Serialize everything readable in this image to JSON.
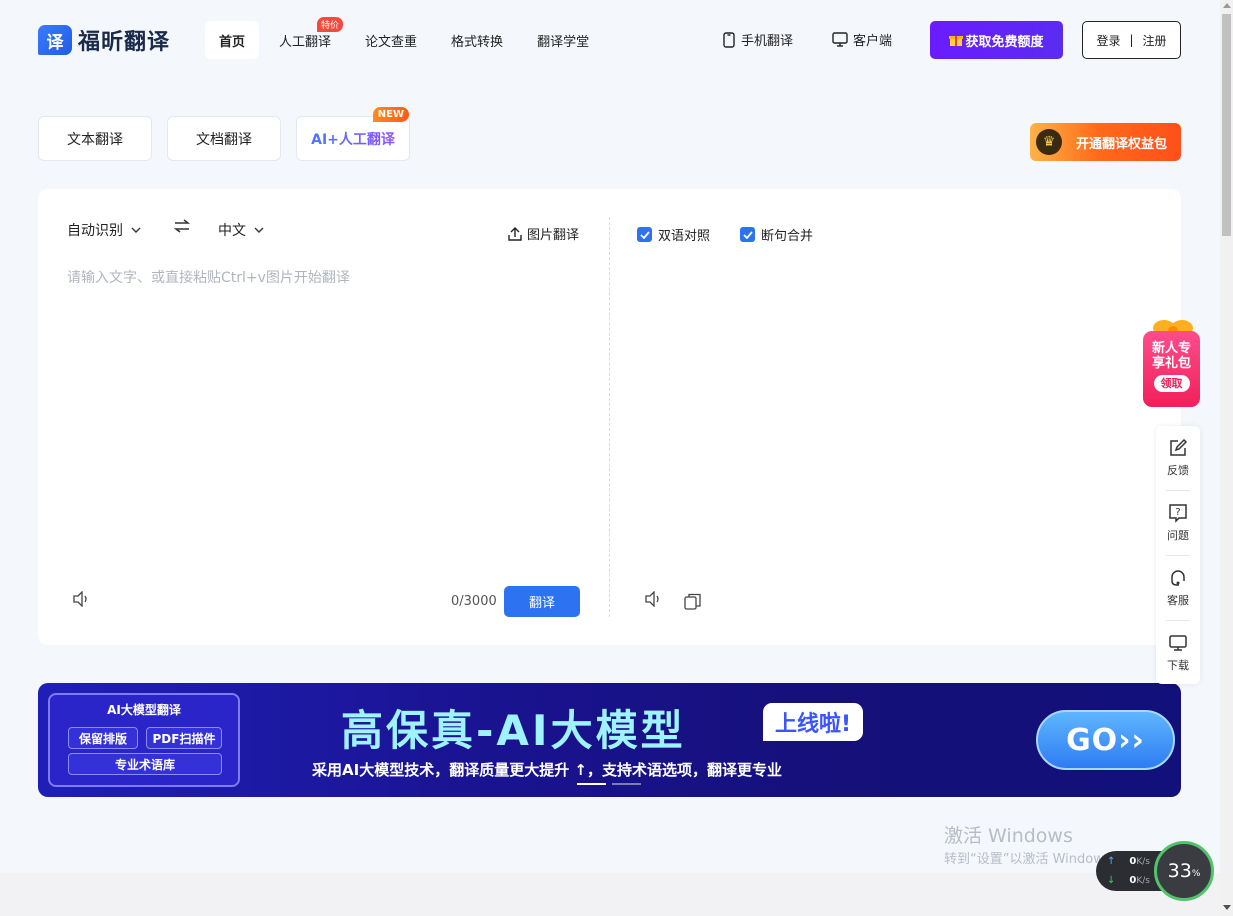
{
  "header": {
    "logo_mark": "译",
    "logo_text": "福昕翻译",
    "nav": [
      {
        "label": "首页",
        "active": true
      },
      {
        "label": "人工翻译",
        "badge": "特价"
      },
      {
        "label": "论文查重"
      },
      {
        "label": "格式转换"
      },
      {
        "label": "翻译学堂"
      }
    ],
    "mobile_label": "手机翻译",
    "client_label": "客户端",
    "free_quota_label": "获取免费额度",
    "login_label": "登录",
    "separator": "|",
    "register_label": "注册"
  },
  "mode_tabs": {
    "text": "文本翻译",
    "document": "文档翻译",
    "ai_human": "AI+人工翻译",
    "new_badge": "NEW"
  },
  "benefit_label": "开通翻译权益包",
  "translator": {
    "source_lang": "自动识别",
    "target_lang": "中文",
    "image_translate_label": "图片翻译",
    "placeholder": "请输入文字、或直接粘贴Ctrl+v图片开始翻译",
    "counter": "0/3000",
    "translate_label": "翻译",
    "bilingual_label": "双语对照",
    "merge_sentences_label": "断句合并"
  },
  "banner": {
    "chip_title": "AI大模型翻译",
    "chip_items": [
      "保留排版",
      "PDF扫描件",
      "专业术语库"
    ],
    "headline": "高保真-AI大模型",
    "badge": "上线啦!",
    "subtitle": "采用AI大模型技术，翻译质量更大提升 ↑，支持术语选项，翻译更专业",
    "go_label": "GO››",
    "slides_total": 2,
    "active_slide": 1
  },
  "gift": {
    "line1": "新人专",
    "line2": "享礼包",
    "cta": "领取"
  },
  "side_panel": [
    {
      "label": "反馈",
      "icon": "edit-icon"
    },
    {
      "label": "问题",
      "icon": "question-icon"
    },
    {
      "label": "客服",
      "icon": "headset-icon"
    },
    {
      "label": "下载",
      "icon": "monitor-icon"
    }
  ],
  "watermark": {
    "line1": "激活 Windows",
    "line2": "转到“设置”以激活 Windows。"
  },
  "speed_widget": {
    "up": "0",
    "down": "0",
    "unit": "K/s",
    "percent": "33",
    "percent_unit": "%"
  },
  "colors": {
    "primary": "#2d72f0",
    "purple": "#6a1cff",
    "badge_red": "#f24b3d",
    "gift_pink": "#f0205a"
  }
}
